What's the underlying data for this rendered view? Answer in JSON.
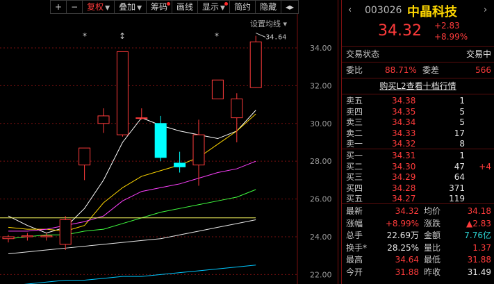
{
  "toolbar": {
    "items": [
      {
        "label": "+",
        "active": false,
        "arrow": false,
        "dot": false
      },
      {
        "label": "−",
        "active": false,
        "arrow": false,
        "dot": false
      },
      {
        "label": "复权",
        "active": true,
        "arrow": true,
        "dot": false
      },
      {
        "label": "叠加",
        "active": false,
        "arrow": true,
        "dot": false
      },
      {
        "label": "筹码",
        "active": false,
        "arrow": false,
        "dot": true
      },
      {
        "label": "画线",
        "active": false,
        "arrow": false,
        "dot": false
      },
      {
        "label": "显示",
        "active": false,
        "arrow": true,
        "dot": true
      },
      {
        "label": "简约",
        "active": false,
        "arrow": false,
        "dot": false
      },
      {
        "label": "隐藏",
        "active": false,
        "arrow": false,
        "dot": false
      },
      {
        "label": "◂▸",
        "active": false,
        "arrow": false,
        "dot": false
      }
    ]
  },
  "chart_data": {
    "type": "candlestick",
    "overlay_label": "设置均线",
    "high_marker": "34.64",
    "ylim": [
      21.5,
      35.8
    ],
    "y_ticks": [
      "34.00",
      "32.00",
      "30.00",
      "28.00",
      "26.00",
      "24.00",
      "22.00"
    ],
    "event_markers": [
      "*",
      "↕",
      "*"
    ],
    "candles": [
      {
        "o": 23.9,
        "h": 24.1,
        "l": 23.7,
        "c": 24.0,
        "up": true
      },
      {
        "o": 24.0,
        "h": 24.2,
        "l": 23.8,
        "c": 24.05,
        "up": true
      },
      {
        "o": 24.0,
        "h": 24.2,
        "l": 23.8,
        "c": 24.05,
        "up": true
      },
      {
        "o": 23.6,
        "h": 25.1,
        "l": 23.3,
        "c": 24.9,
        "up": true
      },
      {
        "o": 27.8,
        "h": 28.7,
        "l": 27.0,
        "c": 28.7,
        "up": true
      },
      {
        "o": 30.0,
        "h": 30.8,
        "l": 29.5,
        "c": 30.4,
        "up": true
      },
      {
        "o": 29.4,
        "h": 33.8,
        "l": 29.3,
        "c": 33.8,
        "up": true
      },
      {
        "o": 30.3,
        "h": 30.8,
        "l": 30.2,
        "c": 30.3,
        "up": true
      },
      {
        "o": 30.0,
        "h": 30.4,
        "l": 28.0,
        "c": 28.2,
        "up": false
      },
      {
        "o": 27.9,
        "h": 28.5,
        "l": 27.4,
        "c": 27.7,
        "up": false
      },
      {
        "o": 27.8,
        "h": 30.2,
        "l": 26.7,
        "c": 29.4,
        "up": true
      },
      {
        "o": 31.3,
        "h": 32.3,
        "l": 31.3,
        "c": 32.3,
        "up": true
      },
      {
        "o": 30.3,
        "h": 31.6,
        "l": 29.0,
        "c": 31.3,
        "up": true
      },
      {
        "o": 31.9,
        "h": 34.64,
        "l": 31.88,
        "c": 34.32,
        "up": true
      }
    ],
    "moving_averages": [
      {
        "color": "#ffffff",
        "values": [
          25.1,
          24.6,
          24.2,
          24.5,
          25.5,
          27.0,
          29.0,
          30.3,
          29.9,
          29.6,
          29.4,
          29.2,
          29.6,
          30.7
        ]
      },
      {
        "color": "#ffd700",
        "values": [
          24.5,
          24.4,
          24.4,
          24.3,
          24.6,
          25.8,
          26.6,
          27.2,
          27.5,
          27.8,
          28.2,
          28.9,
          29.6,
          30.5
        ]
      },
      {
        "color": "#ff40ff",
        "values": [
          24.3,
          24.3,
          24.4,
          24.6,
          24.8,
          25.1,
          25.9,
          26.4,
          26.6,
          26.8,
          27.1,
          27.4,
          27.6,
          28.0
        ]
      },
      {
        "color": "#40ff40",
        "values": [
          23.9,
          24.0,
          24.1,
          24.1,
          24.3,
          24.4,
          24.7,
          25.0,
          25.3,
          25.5,
          25.7,
          25.9,
          26.1,
          26.5
        ]
      },
      {
        "color": "#e8e8e8",
        "values": [
          23.1,
          23.2,
          23.3,
          23.4,
          23.5,
          23.6,
          23.7,
          23.8,
          23.9,
          24.1,
          24.3,
          24.5,
          24.7,
          24.9
        ]
      },
      {
        "color": "#00c8ff",
        "values": [
          21.4,
          21.5,
          21.6,
          21.7,
          21.7,
          21.8,
          21.9,
          21.9,
          22.0,
          22.1,
          22.2,
          22.3,
          22.4,
          22.5
        ]
      },
      {
        "color": "#ffff60",
        "values": [
          25.0,
          25.0,
          25.0,
          25.0,
          25.0,
          25.0,
          25.0,
          25.0,
          25.0,
          25.0,
          25.0,
          25.0,
          25.0,
          25.0
        ]
      }
    ]
  },
  "stock": {
    "code": "003026",
    "name": "中晶科技",
    "price": "34.32",
    "change": "+2.83",
    "change_pct": "+8.99%"
  },
  "status": {
    "label": "交易状态",
    "value": "交易中"
  },
  "ratio": {
    "label1": "委比",
    "value1": "88.71%",
    "label2": "委差",
    "value2": "566"
  },
  "level2_link": "购买L2查看十档行情",
  "sell_orders": [
    {
      "label": "卖五",
      "price": "34.38",
      "qty": "1",
      "extra": ""
    },
    {
      "label": "卖四",
      "price": "34.35",
      "qty": "5",
      "extra": ""
    },
    {
      "label": "卖三",
      "price": "34.34",
      "qty": "5",
      "extra": ""
    },
    {
      "label": "卖二",
      "price": "34.33",
      "qty": "17",
      "extra": ""
    },
    {
      "label": "卖一",
      "price": "34.32",
      "qty": "8",
      "extra": ""
    }
  ],
  "buy_orders": [
    {
      "label": "买一",
      "price": "34.31",
      "qty": "1",
      "extra": ""
    },
    {
      "label": "买二",
      "price": "34.30",
      "qty": "47",
      "extra": "+4"
    },
    {
      "label": "买三",
      "price": "34.29",
      "qty": "64",
      "extra": ""
    },
    {
      "label": "买四",
      "price": "34.28",
      "qty": "371",
      "extra": ""
    },
    {
      "label": "买五",
      "price": "34.27",
      "qty": "119",
      "extra": ""
    }
  ],
  "stats": [
    {
      "l1": "最新",
      "v1": "34.32",
      "c1": "red",
      "l2": "均价",
      "v2": "34.18",
      "c2": "red"
    },
    {
      "l1": "涨幅",
      "v1": "+8.99%",
      "c1": "red",
      "l2": "涨跌",
      "v2": "▲2.83",
      "c2": "red"
    },
    {
      "l1": "总手",
      "v1": "22.69万",
      "c1": "wht",
      "l2": "金额",
      "v2": "7.76亿",
      "c2": "grn"
    },
    {
      "l1": "换手*",
      "v1": "28.25%",
      "c1": "wht",
      "l2": "量比",
      "v2": "1.37",
      "c2": "red"
    },
    {
      "l1": "最高",
      "v1": "34.64",
      "c1": "red",
      "l2": "最低",
      "v2": "31.88",
      "c2": "red"
    },
    {
      "l1": "今开",
      "v1": "31.88",
      "c1": "red",
      "l2": "昨收",
      "v2": "31.49",
      "c2": "wht"
    }
  ]
}
